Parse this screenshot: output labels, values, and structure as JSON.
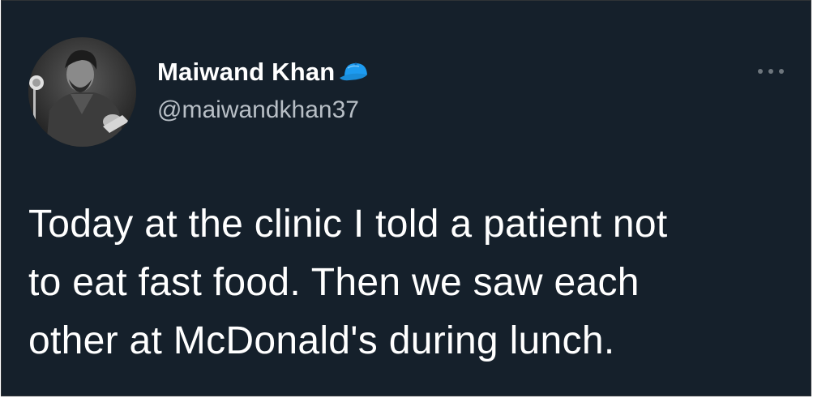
{
  "author": {
    "display_name": "Maiwand Khan",
    "handle": "@maiwandkhan37",
    "avatar_icon": "profile-photo",
    "badge_icon": "blue-cap-icon"
  },
  "menu": {
    "more_icon": "ellipsis-icon"
  },
  "tweet": {
    "lines": [
      "Today at the clinic I told a patient not",
      "to eat fast food. Then we saw each",
      "other at McDonald's during lunch."
    ]
  },
  "colors": {
    "background": "#15202b",
    "text": "#ffffff",
    "handle": "#b8bfc6",
    "cap_blue": "#1d9bf0"
  }
}
